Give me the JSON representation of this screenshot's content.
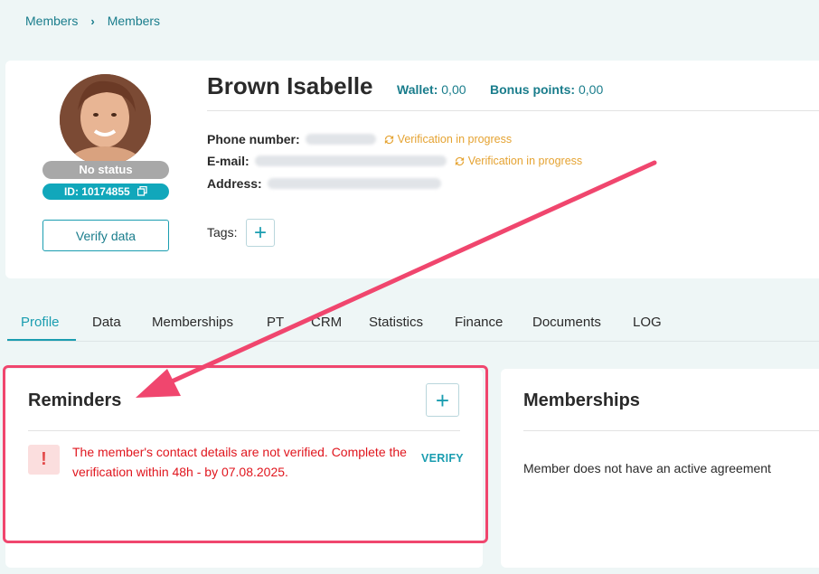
{
  "breadcrumb": {
    "items": [
      "Members",
      "Members"
    ]
  },
  "member": {
    "name": "Brown Isabelle",
    "wallet_label": "Wallet:",
    "wallet_value": "0,00",
    "bonus_label": "Bonus points:",
    "bonus_value": "0,00",
    "status": "No status",
    "id": "ID: 10174855",
    "verify_button": "Verify data"
  },
  "contact": {
    "phone_label": "Phone number:",
    "email_label": "E-mail:",
    "address_label": "Address:",
    "verification_status": "Verification in progress",
    "tags_label": "Tags:"
  },
  "tabs": [
    {
      "label": "Profile",
      "active": true
    },
    {
      "label": "Data"
    },
    {
      "label": "Memberships"
    },
    {
      "label": "PT"
    },
    {
      "label": "CRM"
    },
    {
      "label": "Statistics"
    },
    {
      "label": "Finance"
    },
    {
      "label": "Documents"
    },
    {
      "label": "LOG"
    }
  ],
  "reminders": {
    "title": "Reminders",
    "items": [
      {
        "icon": "!",
        "text": "The member's contact details are not verified. Complete the verification within 48h - by 07.08.2025.",
        "action": "VERIFY"
      }
    ]
  },
  "memberships": {
    "title": "Memberships",
    "empty_text": "Member does not have an active agreement"
  },
  "colors": {
    "accent": "#1a9db0",
    "link": "#1a7d8c",
    "warning": "#e5a332",
    "error": "#e0161e",
    "annotation": "#f0466e",
    "background": "#eef6f6"
  },
  "icons": {
    "copy": "copy-icon",
    "sync": "sync-icon",
    "add": "plus-icon",
    "breadcrumb_separator": "chevron-right-icon"
  }
}
